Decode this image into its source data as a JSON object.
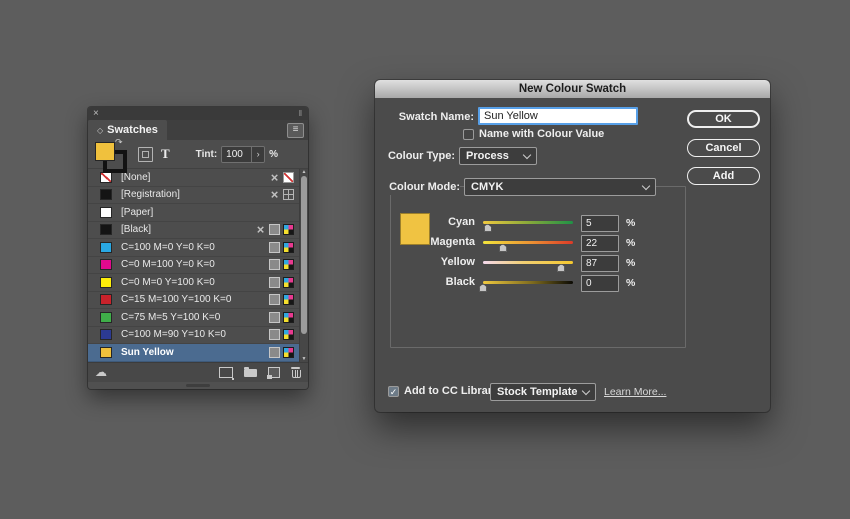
{
  "colors": {
    "desktop_bg": "#5d5d5d",
    "panel_bg": "#4d4d4d",
    "dialog_bg": "#4b4b4b",
    "selection_blue": "#4b6b90",
    "focus_ring_blue": "#58a0e8",
    "sun_yellow": "#f0c13d"
  },
  "panel": {
    "tab": "Swatches",
    "tint_label": "Tint:",
    "tint_value": "100",
    "percent": "%",
    "text_tool": "T",
    "footer_icons": [
      "cc-libraries",
      "swatch-views",
      "new-colour-group",
      "new-swatch",
      "delete-swatch"
    ],
    "swatches": [
      {
        "name": "[None]",
        "color": "none",
        "icons": [
          "no-edit",
          "none"
        ]
      },
      {
        "name": "[Registration]",
        "color": "#141414",
        "icons": [
          "no-edit",
          "registration"
        ]
      },
      {
        "name": "[Paper]",
        "color": "#ffffff",
        "icons": []
      },
      {
        "name": "[Black]",
        "color": "#141414",
        "icons": [
          "no-edit",
          "process",
          "cmyk"
        ]
      },
      {
        "name": "C=100 M=0 Y=0 K=0",
        "color": "#29a8e3",
        "icons": [
          "process",
          "cmyk"
        ]
      },
      {
        "name": "C=0 M=100 Y=0 K=0",
        "color": "#e2098d",
        "icons": [
          "process",
          "cmyk"
        ]
      },
      {
        "name": "C=0 M=0 Y=100 K=0",
        "color": "#fdee0a",
        "icons": [
          "process",
          "cmyk"
        ]
      },
      {
        "name": "C=15 M=100 Y=100 K=0",
        "color": "#c9222b",
        "icons": [
          "process",
          "cmyk"
        ]
      },
      {
        "name": "C=75 M=5 Y=100 K=0",
        "color": "#3fae49",
        "icons": [
          "process",
          "cmyk"
        ]
      },
      {
        "name": "C=100 M=90 Y=10 K=0",
        "color": "#2c3a92",
        "icons": [
          "process",
          "cmyk"
        ]
      },
      {
        "name": "Sun Yellow",
        "color": "#f0c13d",
        "icons": [
          "process",
          "cmyk"
        ],
        "selected": true
      }
    ]
  },
  "dialog": {
    "title": "New Colour Swatch",
    "fields": {
      "swatch_name_label": "Swatch Name:",
      "swatch_name_value": "Sun Yellow",
      "name_with_colour_value_label": "Name with Colour Value",
      "colour_type_label": "Colour Type:",
      "colour_type_value": "Process",
      "colour_mode_label": "Colour Mode:",
      "colour_mode_value": "CMYK"
    },
    "preview_color": "#f0c342",
    "unit": "%",
    "sliders": [
      {
        "label": "Cyan",
        "value": "5",
        "percent": 5,
        "track": [
          "#efc93f",
          "#8aa93a 50%",
          "#1f9246"
        ]
      },
      {
        "label": "Magenta",
        "value": "22",
        "percent": 22,
        "track": [
          "#f2e43c",
          "#eb8f33 55%",
          "#dc3a28"
        ]
      },
      {
        "label": "Yellow",
        "value": "87",
        "percent": 87,
        "track": [
          "#f4d9ee",
          "#f2cf73 45%",
          "#f4c82e"
        ]
      },
      {
        "label": "Black",
        "value": "0",
        "percent": 0,
        "track": [
          "#efc93f",
          "#7d6a1e 55%",
          "#0b0a04"
        ]
      }
    ],
    "buttons": [
      {
        "label": "OK",
        "default": true
      },
      {
        "label": "Cancel"
      },
      {
        "label": "Add"
      }
    ],
    "footer": {
      "add_to_cc_label": "Add to CC Library:",
      "cc_library_value": "Stock Templates",
      "learn_more": "Learn More..."
    }
  }
}
